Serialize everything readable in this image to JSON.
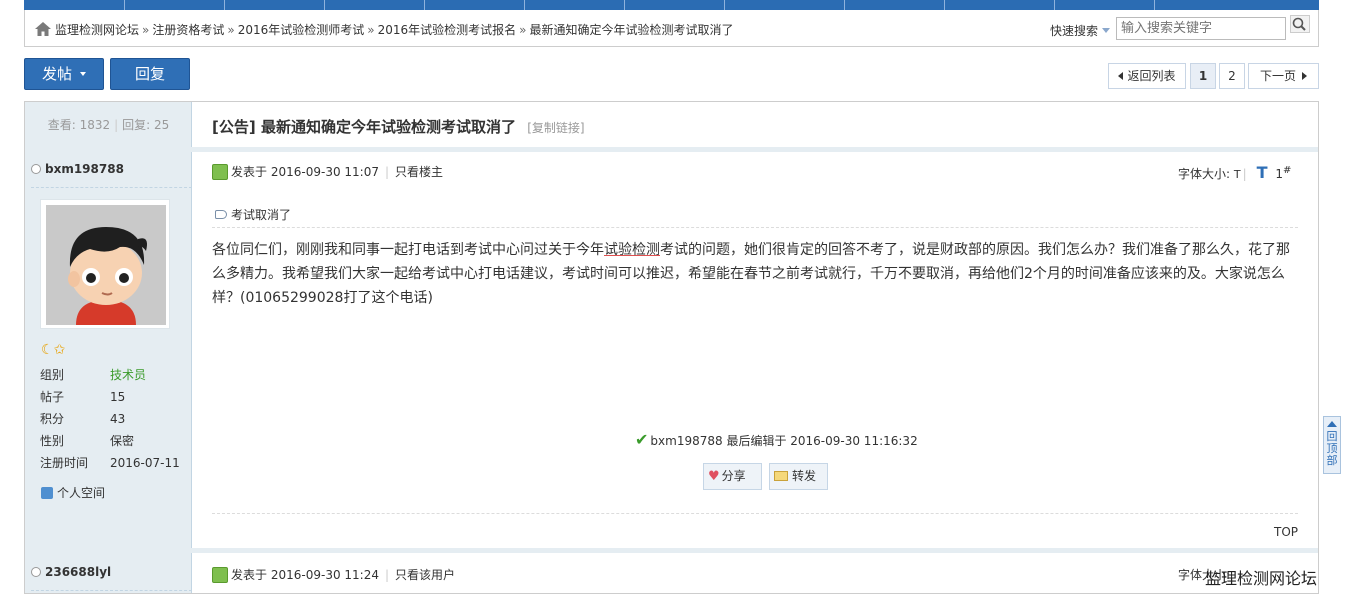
{
  "breadcrumb": {
    "items": [
      "监理检测网论坛",
      "注册资格考试",
      "2016年试验检测师考试",
      "2016年试验检测考试报名",
      "最新通知确定今年试验检测考试取消了"
    ],
    "separator": "»"
  },
  "search": {
    "label": "快速搜索",
    "placeholder": "输入搜索关键字"
  },
  "toolbar": {
    "post_label": "发帖",
    "reply_label": "回复"
  },
  "pager": {
    "back_label": "返回列表",
    "pages": [
      "1",
      "2"
    ],
    "current": "1",
    "next_label": "下一页"
  },
  "thread": {
    "views_label": "查看:",
    "views": "1832",
    "replies_label": "回复:",
    "replies": "25",
    "prefix": "[公告]",
    "title": "最新通知确定今年试验检测考试取消了",
    "copy_link": "[复制链接]"
  },
  "post1": {
    "author": "bxm198788",
    "posted_label": "发表于",
    "posted_time": "2016-09-30 11:07",
    "only_author": "只看楼主",
    "fontsize_label": "字体大小:",
    "fontsize_small": "T",
    "fontsize_big": "T",
    "floor": "1",
    "floor_mark": "#",
    "tag": "考试取消了",
    "content_pre": "各位同仁们，刚刚我和同事一起打电话到考试中心问过关于今年",
    "content_ul": "试验检测",
    "content_post": "考试的问题，她们很肯定的回答不考了，说是财政部的原因。我们怎么办？我们准备了那么久，花了那么多精力。我希望我们大家一起给考试中心打电话建议，考试时间可以推迟，希望能在春节之前考试就行，千万不要取消，再给他们2个月的时间准备应该来的及。大家说怎么样？(01065299028打了这个电话)",
    "edited_text": "bxm198788 最后编辑于 2016-09-30 11:16:32",
    "share_label": "分享",
    "forward_label": "转发",
    "top_label": "TOP",
    "profile": {
      "rows": [
        {
          "k": "组别",
          "v": "技术员"
        },
        {
          "k": "帖子",
          "v": "15"
        },
        {
          "k": "积分",
          "v": "43"
        },
        {
          "k": "性别",
          "v": "保密"
        },
        {
          "k": "注册时间",
          "v": "2016-07-11"
        }
      ],
      "space_label": "个人空间"
    }
  },
  "post2": {
    "author": "236688lyl",
    "posted_label": "发表于",
    "posted_time": "2016-09-30 11:24",
    "only_user": "只看该用户",
    "fontsize_label": "字体大小:"
  },
  "back_top_label": "回顶部",
  "watermark": "监理检测网论坛",
  "colors": {
    "brand_blue": "#2f6fb6",
    "sidebar_bg": "#e5edf2",
    "group_green": "#3a9b2b"
  }
}
